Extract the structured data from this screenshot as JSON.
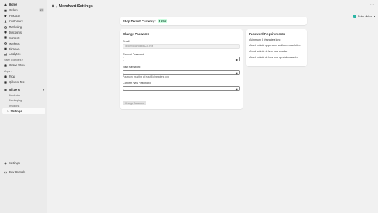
{
  "sidebar": {
    "items": [
      {
        "label": "Home",
        "icon": "home-icon"
      },
      {
        "label": "Orders",
        "icon": "orders-icon",
        "badge": "27"
      },
      {
        "label": "Products",
        "icon": "products-icon"
      },
      {
        "label": "Customers",
        "icon": "customers-icon"
      },
      {
        "label": "Marketing",
        "icon": "marketing-icon"
      },
      {
        "label": "Discounts",
        "icon": "discounts-icon"
      },
      {
        "label": "Content",
        "icon": "content-icon"
      },
      {
        "label": "Markets",
        "icon": "markets-icon"
      },
      {
        "label": "Finance",
        "icon": "finance-icon"
      },
      {
        "label": "Analytics",
        "icon": "analytics-icon"
      }
    ],
    "sales_channels_label": "Sales channels",
    "online_store": "Online Store",
    "apps_label": "Apps",
    "apps": [
      {
        "label": "Flow",
        "icon": "flow-icon"
      },
      {
        "label": "Qikvers Test",
        "icon": "app-icon"
      }
    ],
    "qikvers": {
      "label": "Qikvers",
      "subitems": [
        "Products",
        "Packaging",
        "Invoices",
        "Settings"
      ]
    },
    "settings": "Settings",
    "dev_console": "Dev Console"
  },
  "header": {
    "title": "Merchant Settings"
  },
  "user": {
    "name": "Ruby Mehra"
  },
  "currency": {
    "label": "Shop Default Currency:",
    "value": "$ USD"
  },
  "change_password": {
    "title": "Change Password",
    "email_label": "Email",
    "email_value": "@dominowedding123.bros",
    "current_label": "Current Password",
    "new_label": "New Password",
    "new_help": "Password must be at least 8 characters long",
    "confirm_label": "Confirm New Password",
    "button_label": "Change Password"
  },
  "requirements": {
    "title": "Password Requirements",
    "items": [
      "• Minimum 8 characters long",
      "• Must include uppercase and lowercase letters",
      "• Must include at least one number",
      "• Must include at least one special character"
    ]
  },
  "colors": {
    "sidebar_bg": "#ebebeb",
    "accent_green": "#cdfee1",
    "avatar": "#2bb5a5"
  }
}
